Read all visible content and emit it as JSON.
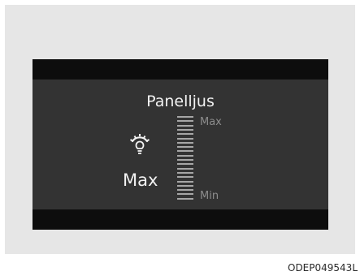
{
  "display": {
    "title": "Panelljus",
    "current_value": "Max",
    "scale_max_label": "Max",
    "scale_min_label": "Min",
    "icon": "panel-light-icon",
    "brightness_level_fraction": 1.0,
    "gauge_segments": 20
  },
  "figure_code": "ODEP049543L"
}
